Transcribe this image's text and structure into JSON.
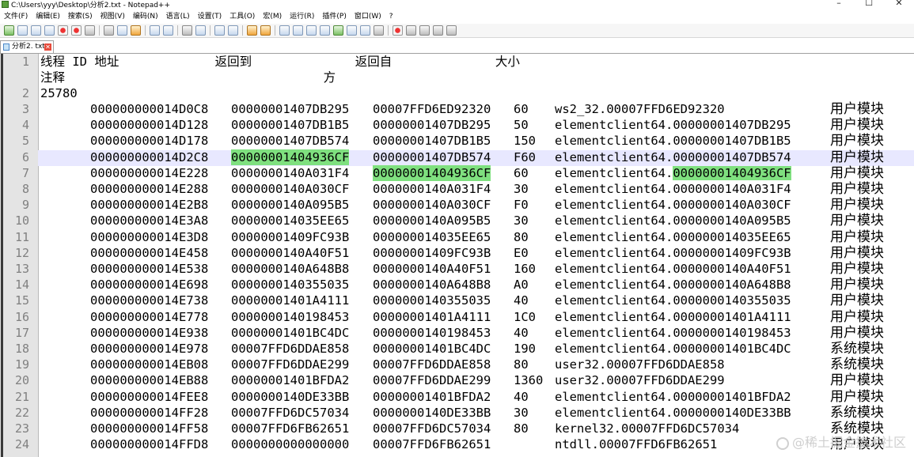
{
  "window": {
    "title": "C:\\Users\\yyy\\Desktop\\分析2.txt - Notepad++",
    "controls": [
      "–",
      "☐",
      "✕"
    ]
  },
  "menu": [
    "文件(F)",
    "编辑(E)",
    "搜索(S)",
    "视图(V)",
    "编码(N)",
    "语言(L)",
    "设置(T)",
    "工具(O)",
    "宏(M)",
    "运行(R)",
    "插件(P)",
    "窗口(W)",
    "?"
  ],
  "tab": {
    "label": "分析2. txt"
  },
  "header": {
    "line1_num": "1",
    "line1_text": "线程 ID 地址             返回到              返回自              大小",
    "line1_cont": "注释                                   方",
    "line2_num": "2",
    "line2_text": "25780"
  },
  "rows": [
    {
      "n": "3",
      "addr": "000000000014D0C8",
      "ret_to": "00000001407DB295",
      "ret_from": "00007FFD6ED92320",
      "size": "60",
      "mod": "ws2_32.",
      "modaddr": "00007FFD6ED92320",
      "note": "用户模块"
    },
    {
      "n": "4",
      "addr": "000000000014D128",
      "ret_to": "00000001407DB1B5",
      "ret_from": "00000001407DB295",
      "size": "50",
      "mod": "elementclient64.",
      "modaddr": "00000001407DB295",
      "note": "用户模块"
    },
    {
      "n": "5",
      "addr": "000000000014D178",
      "ret_to": "00000001407DB574",
      "ret_from": "00000001407DB1B5",
      "size": "150",
      "mod": "elementclient64.",
      "modaddr": "00000001407DB1B5",
      "note": "用户模块"
    },
    {
      "n": "6",
      "addr": "000000000014D2C8",
      "ret_to": "00000001404936CF",
      "ret_from": "00000001407DB574",
      "size": "F60",
      "mod": "elementclient64.",
      "modaddr": "00000001407DB574",
      "note": "用户模块"
    },
    {
      "n": "7",
      "addr": "000000000014E228",
      "ret_to": "0000000140A031F4",
      "ret_from": "00000001404936CF",
      "size": "60",
      "mod": "elementclient64.",
      "modaddr": "00000001404936CF",
      "note": "用户模块"
    },
    {
      "n": "8",
      "addr": "000000000014E288",
      "ret_to": "0000000140A030CF",
      "ret_from": "0000000140A031F4",
      "size": "30",
      "mod": "elementclient64.",
      "modaddr": "0000000140A031F4",
      "note": "用户模块"
    },
    {
      "n": "9",
      "addr": "000000000014E2B8",
      "ret_to": "0000000140A095B5",
      "ret_from": "0000000140A030CF",
      "size": "F0",
      "mod": "elementclient64.",
      "modaddr": "0000000140A030CF",
      "note": "用户模块"
    },
    {
      "n": "10",
      "addr": "000000000014E3A8",
      "ret_to": "000000014035EE65",
      "ret_from": "0000000140A095B5",
      "size": "30",
      "mod": "elementclient64.",
      "modaddr": "0000000140A095B5",
      "note": "用户模块"
    },
    {
      "n": "11",
      "addr": "000000000014E3D8",
      "ret_to": "00000001409FC93B",
      "ret_from": "000000014035EE65",
      "size": "80",
      "mod": "elementclient64.",
      "modaddr": "000000014035EE65",
      "note": "用户模块"
    },
    {
      "n": "12",
      "addr": "000000000014E458",
      "ret_to": "0000000140A40F51",
      "ret_from": "00000001409FC93B",
      "size": "E0",
      "mod": "elementclient64.",
      "modaddr": "00000001409FC93B",
      "note": "用户模块"
    },
    {
      "n": "13",
      "addr": "000000000014E538",
      "ret_to": "0000000140A648B8",
      "ret_from": "0000000140A40F51",
      "size": "160",
      "mod": "elementclient64.",
      "modaddr": "0000000140A40F51",
      "note": "用户模块"
    },
    {
      "n": "14",
      "addr": "000000000014E698",
      "ret_to": "0000000140355035",
      "ret_from": "0000000140A648B8",
      "size": "A0",
      "mod": "elementclient64.",
      "modaddr": "0000000140A648B8",
      "note": "用户模块"
    },
    {
      "n": "15",
      "addr": "000000000014E738",
      "ret_to": "00000001401A4111",
      "ret_from": "0000000140355035",
      "size": "40",
      "mod": "elementclient64.",
      "modaddr": "0000000140355035",
      "note": "用户模块"
    },
    {
      "n": "16",
      "addr": "000000000014E778",
      "ret_to": "0000000140198453",
      "ret_from": "00000001401A4111",
      "size": "1C0",
      "mod": "elementclient64.",
      "modaddr": "00000001401A4111",
      "note": "用户模块"
    },
    {
      "n": "17",
      "addr": "000000000014E938",
      "ret_to": "00000001401BC4DC",
      "ret_from": "0000000140198453",
      "size": "40",
      "mod": "elementclient64.",
      "modaddr": "0000000140198453",
      "note": "用户模块"
    },
    {
      "n": "18",
      "addr": "000000000014E978",
      "ret_to": "00007FFD6DDAE858",
      "ret_from": "00000001401BC4DC",
      "size": "190",
      "mod": "elementclient64.",
      "modaddr": "00000001401BC4DC",
      "note": "系统模块"
    },
    {
      "n": "19",
      "addr": "000000000014EB08",
      "ret_to": "00007FFD6DDAE299",
      "ret_from": "00007FFD6DDAE858",
      "size": "80",
      "mod": "user32.",
      "modaddr": "00007FFD6DDAE858",
      "note": "系统模块"
    },
    {
      "n": "20",
      "addr": "000000000014EB88",
      "ret_to": "00000001401BFDA2",
      "ret_from": "00007FFD6DDAE299",
      "size": "1360",
      "mod": "user32.",
      "modaddr": "00007FFD6DDAE299",
      "note": "用户模块"
    },
    {
      "n": "21",
      "addr": "000000000014FEE8",
      "ret_to": "0000000140DE33BB",
      "ret_from": "00000001401BFDA2",
      "size": "40",
      "mod": "elementclient64.",
      "modaddr": "00000001401BFDA2",
      "note": "用户模块"
    },
    {
      "n": "22",
      "addr": "000000000014FF28",
      "ret_to": "00007FFD6DC57034",
      "ret_from": "0000000140DE33BB",
      "size": "30",
      "mod": "elementclient64.",
      "modaddr": "0000000140DE33BB",
      "note": "系统模块"
    },
    {
      "n": "23",
      "addr": "000000000014FF58",
      "ret_to": "00007FFD6FB62651",
      "ret_from": "00007FFD6DC57034",
      "size": "80",
      "mod": "kernel32.",
      "modaddr": "00007FFD6DC57034",
      "note": "系统模块"
    },
    {
      "n": "24",
      "addr": "000000000014FFD8",
      "ret_to": "0000000000000000",
      "ret_from": "00007FFD6FB62651",
      "size": "",
      "mod": "ntdll.",
      "modaddr": "00007FFD6FB62651",
      "note": "用户模块"
    }
  ],
  "watermark": "@稀土掘金技术社区",
  "colors": {
    "highlight": "#7fe07f",
    "current_line": "#e8e8ff",
    "gutter": "#e4e4e4"
  }
}
